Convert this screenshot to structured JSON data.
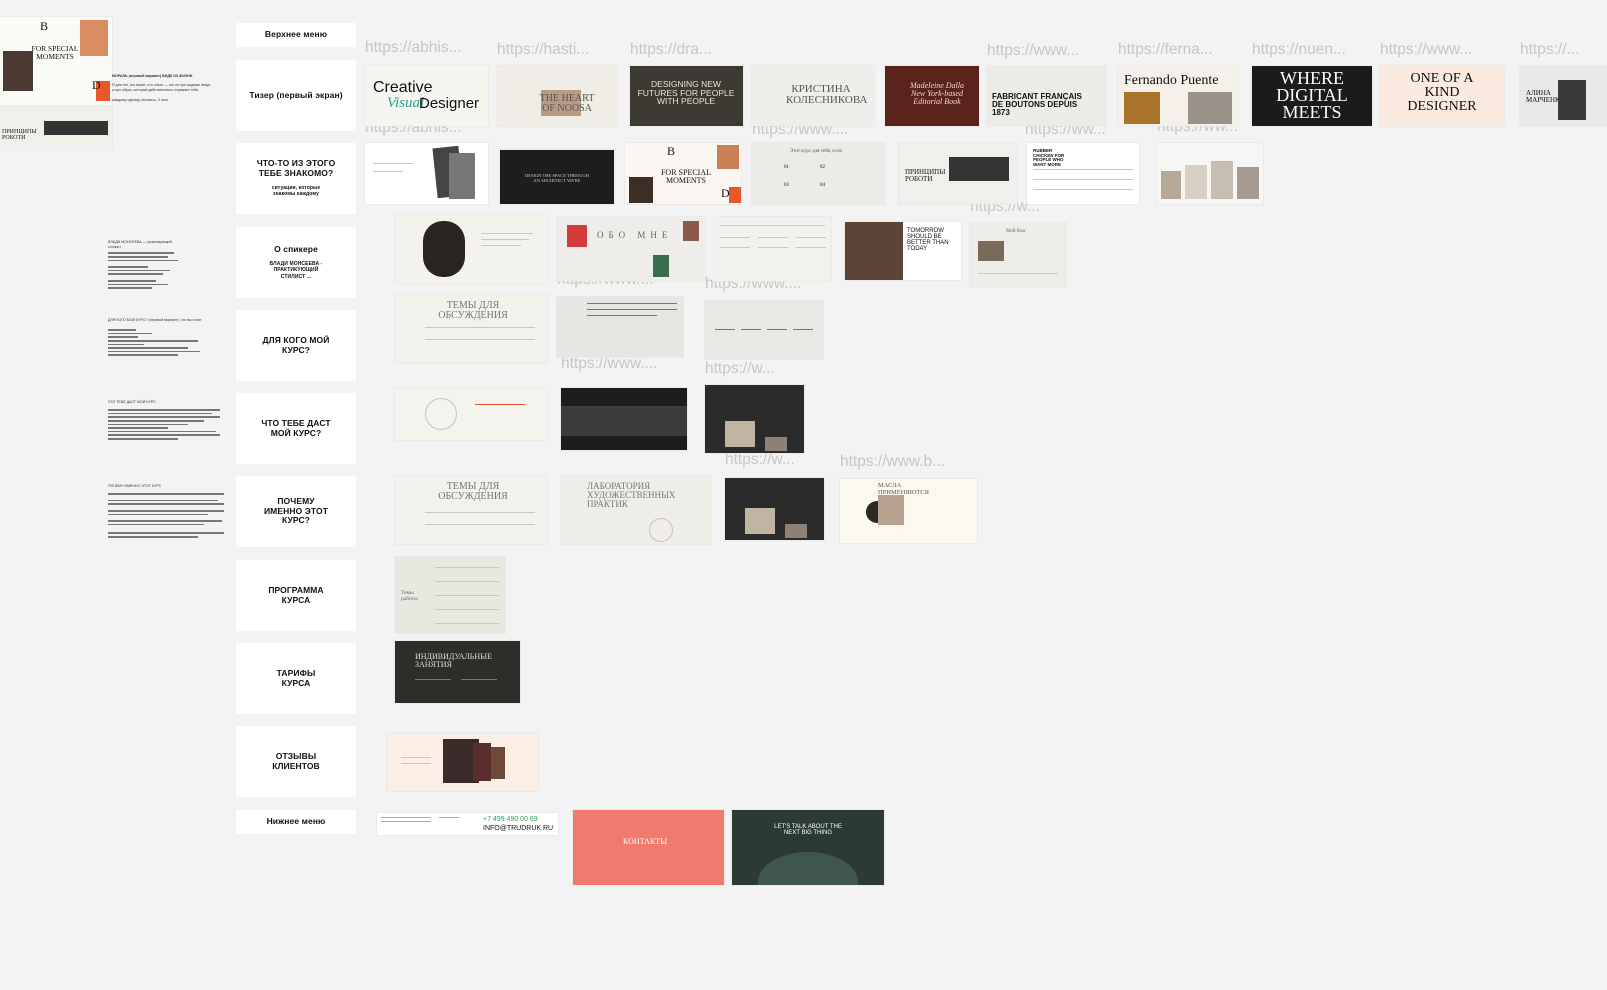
{
  "sections": [
    {
      "key": "top",
      "label": "Верхнее меню",
      "sub": ""
    },
    {
      "key": "teaser",
      "label": "Тизер (первый экран)",
      "sub": ""
    },
    {
      "key": "familiar",
      "label": "Что-то из этого тебе знакомо?",
      "sub": "ситуации, которые знакомы каждому"
    },
    {
      "key": "speaker",
      "label": "О спикере",
      "sub": "Влади Монсеева - практикующий стилист ..."
    },
    {
      "key": "who",
      "label": "Для кого мой курс?",
      "sub": ""
    },
    {
      "key": "gives",
      "label": "Что тебе даст мой курс?",
      "sub": ""
    },
    {
      "key": "why",
      "label": "Почему именно этот курс?",
      "sub": ""
    },
    {
      "key": "program",
      "label": "Программа курса",
      "sub": ""
    },
    {
      "key": "tariffs",
      "label": "Тарифы курса",
      "sub": ""
    },
    {
      "key": "reviews",
      "label": "Отзывы клиентов",
      "sub": ""
    },
    {
      "key": "footer",
      "label": "Нижнее меню",
      "sub": ""
    }
  ],
  "urls": {
    "u1": "https://abhis...",
    "u2": "https://hasti...",
    "u3": "https://dra...",
    "u4": "https://www...",
    "u5": "https://ferna...",
    "u6": "https://nuen...",
    "u7": "https://www...",
    "u8": "https://...",
    "u9": "https://abhis...",
    "u10": "https://www....",
    "u11": "https://ww...",
    "u12": "https://ww...",
    "u13": "https://w...",
    "u14": "https://www....",
    "u15": "https://www....",
    "u16": "https://www....",
    "u17": "https://w...",
    "u18": "https://w...",
    "u19": "https://www.b..."
  },
  "thumbs": {
    "creative_a": "Creative",
    "creative_b": "Visual",
    "creative_c": "Designer",
    "heart": "THE HEART OF NOOSA",
    "designing": "DESIGNING NEW FUTURES FOR PEOPLE WITH PEOPLE",
    "kristina": "КРИСТИНА КОЛЕСНИКОВА",
    "madeleine": "Madeleine Dalla New York-based Editorial Book",
    "fabricant": "FABRICANT FRANÇAIS DE BOUTONS DEPUIS 1873",
    "fernando": "Fernando Puente",
    "where": "WHERE DIGITAL MEETS",
    "oneofakind": "ONE OF A KIND DESIGNER",
    "alina": "АЛИНА МАРЧЕНКО",
    "b_letter": "B",
    "for_special": "FOR SPECIAL MOMENTS",
    "d_letter": "D",
    "principles": "ПРИНЦИПЫ РОБОТИ",
    "ob_mne": "ОБО МНЕ",
    "tomorrow": "TOMORROW SHOULD BE BETTER THAN TODAY",
    "rubber": "RUBBER CHICKEN FOR PEOPLE WHO WANT MORE",
    "temy1": "ТЕМЫ ДЛЯ ОБСУЖДЕНИЯ",
    "temy2": "ТЕМЫ ДЛЯ ОБСУЖДЕНИЯ",
    "laboratoria": "ЛАБОРАТОРИЯ ХУДОЖЕСТВЕННЫХ ПРАКТИК",
    "masla": "МАСЛА ПРИМЕНЯЮТСЯ",
    "individual": "ИНДИВИДУАЛЬНЫЕ ЗАНЯТИЯ",
    "kontakty": "КОНТАКТЫ",
    "letstalk": "LET'S TALK ABOUT THE NEXT BIG THING",
    "phone": "+7 499 490 00 69",
    "email": "INFO@TRUDRUK.RU",
    "temy_raboty": "Темы работы",
    "dark_center": "DESIGN THE SPACE THROUGH AN ARCHITECT WE'RE",
    "nums": [
      "01",
      "02",
      "03",
      "04"
    ],
    "what_for": "Этот курс для тебя, если",
    "blog": "Мой блог"
  },
  "notes": {
    "n1_title": "МОРАЛЬ (игровой вариант) ВИДЕ ИЗ ЖИЗНИ",
    "n1_body": "Я для тех, кто верит, что стиль — это не про модные вещи, а про образ, который действительно отражает тебя.",
    "n1_foot": "каждому одному, пытаюсь, 3 чего",
    "speaker_note": "ВЛАДИ МОНСЕЕВА — практикующий стилист",
    "who_note": "ДЛЯ КОГО МОЙ КУРС? (игровой вариант), что вы стоят",
    "gives_note": "ЧТО ТЕБЕ ДАСТ МОЙ КУРС",
    "why_note": "ПОЧЕМУ ИМЕННО ЭТОТ КУРС"
  },
  "colors": {
    "bg": "#f3f3f3",
    "card": "#ffffff",
    "url": "#c6c6c6",
    "dark": "#2f2d2a",
    "salmon": "#f07a6e",
    "darkgreen": "#2b3a36",
    "orange": "#e8562a"
  }
}
